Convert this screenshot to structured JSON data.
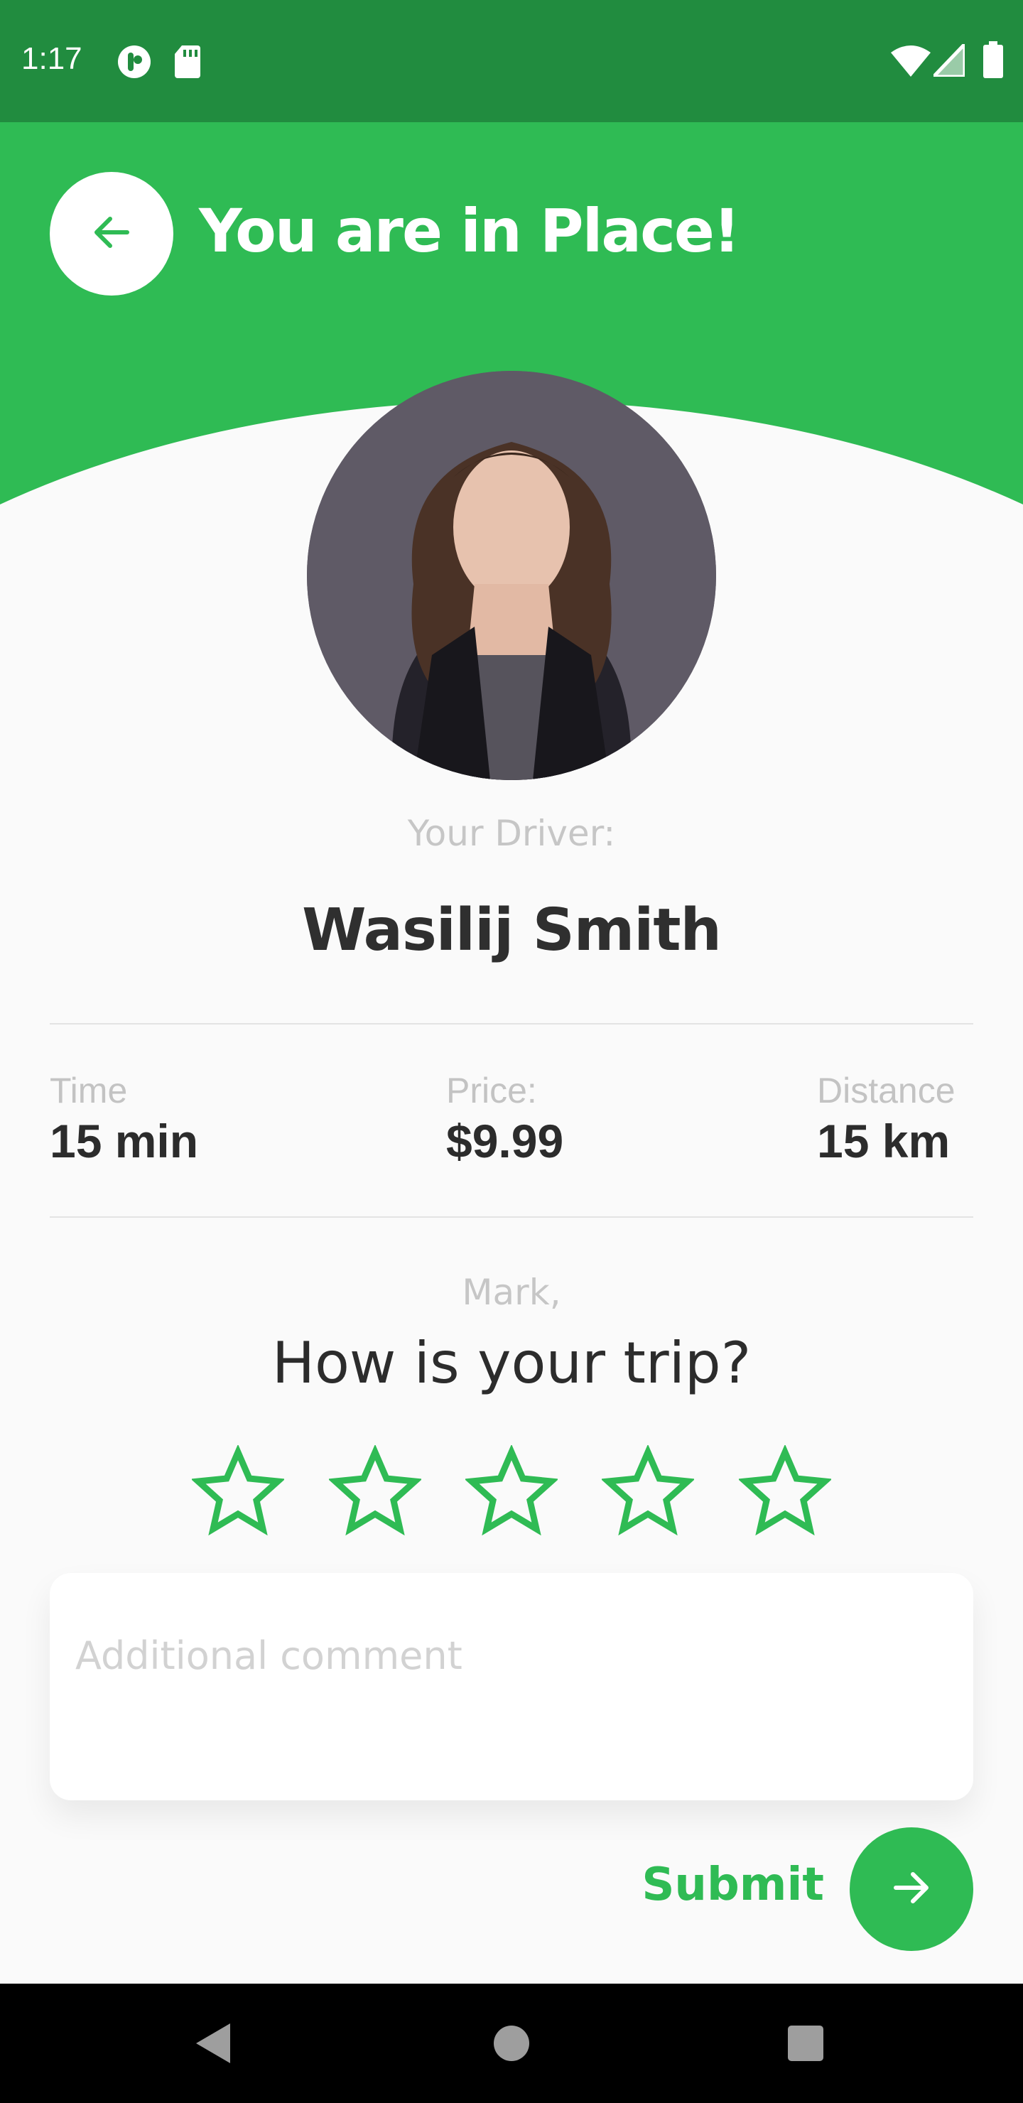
{
  "status_bar": {
    "time": "1:17"
  },
  "header": {
    "title": "You are in Place!"
  },
  "driver": {
    "label": "Your Driver:",
    "name": "Wasilij Smith"
  },
  "trip_stats": [
    {
      "label": "Time",
      "value": "15 min"
    },
    {
      "label": "Price:",
      "value": "$9.99"
    },
    {
      "label": "Distance",
      "value": "15 km"
    }
  ],
  "rating": {
    "greeting": "Mark,",
    "question": "How is your trip?",
    "max_stars": 5,
    "selected": 0
  },
  "comment": {
    "placeholder": "Additional comment",
    "value": ""
  },
  "submit": {
    "label": "Submit"
  },
  "colors": {
    "accent": "#2fbb54",
    "status_bar": "#218c3f",
    "text_dark": "#2c2c2c",
    "text_muted": "#c6c6c6"
  }
}
